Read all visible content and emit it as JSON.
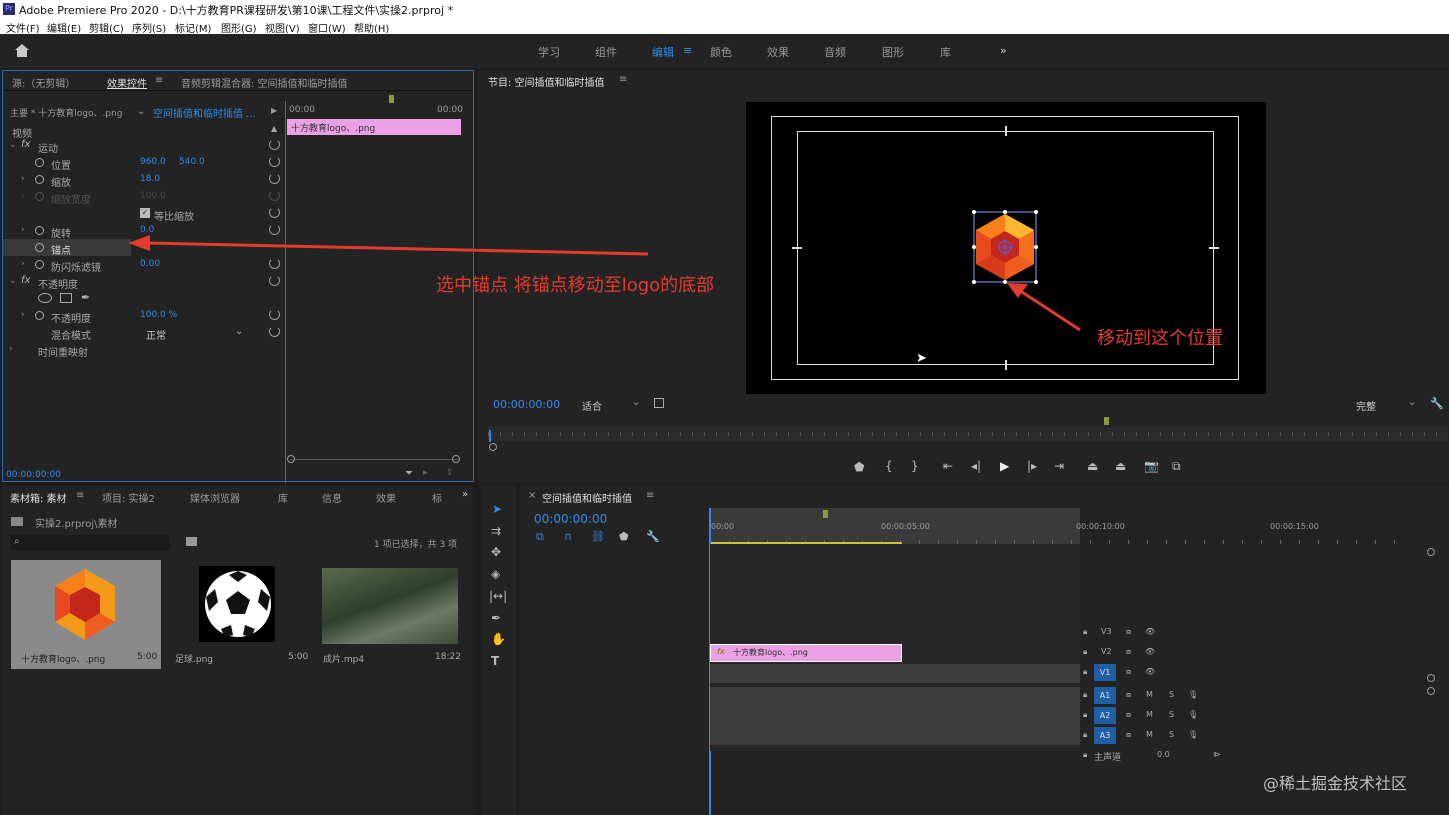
{
  "window": {
    "title": "Adobe Premiere Pro 2020 - D:\\十方教育PR课程研发\\第10课\\工程文件\\实操2.prproj *"
  },
  "menu": [
    "文件(F)",
    "编辑(E)",
    "剪辑(C)",
    "序列(S)",
    "标记(M)",
    "图形(G)",
    "视图(V)",
    "窗口(W)",
    "帮助(H)"
  ],
  "workspaces": [
    "学习",
    "组件",
    "编辑",
    "颜色",
    "效果",
    "音频",
    "图形",
    "库"
  ],
  "workspace_more": "»",
  "effect_controls": {
    "tabs": [
      "源:（无剪辑）",
      "效果控件",
      "音频剪辑混合器: 空间插值和临时插值"
    ],
    "master_clip": "主要 * 十方教育logo、.png",
    "sequence_clip": "空间插值和临时插值 ...",
    "time_start": "00:00",
    "time_end": "00:00",
    "clip_bar": "十方教育logo、.png",
    "section": "视频",
    "motion": "运动",
    "position": "位置",
    "position_x": "960.0",
    "position_y": "540.0",
    "scale": "缩放",
    "scale_val": "18.0",
    "scale_width": "缩放宽度",
    "scale_width_val": "100.0",
    "uniform": "等比缩放",
    "rotation": "旋转",
    "rotation_val": "0.0",
    "anchor": "锚点",
    "anti_flicker": "防闪烁滤镜",
    "anti_flicker_val": "0.00",
    "opacity": "不透明度",
    "opacity_prop": "不透明度",
    "opacity_val": "100.0 %",
    "blend": "混合模式",
    "blend_val": "正常",
    "time_remap": "时间重映射",
    "timecode": "00:00:00:00"
  },
  "annotation_left": "选中锚点 将锚点移动至logo的底部",
  "annotation_right": "移动到这个位置",
  "program": {
    "title": "节目: 空间插值和临时插值",
    "timecode": "00:00:00:00",
    "fit": "适合",
    "quality": "完整"
  },
  "project": {
    "tabs": [
      "素材箱: 素材",
      "项目: 实操2",
      "媒体浏览器",
      "库",
      "信息",
      "效果",
      "标"
    ],
    "path": "实操2.prproj\\素材",
    "selection": "1 项已选择，共 3 项",
    "items": [
      {
        "name": "十方教育logo、.png",
        "dur": "5:00"
      },
      {
        "name": "足球.png",
        "dur": "5:00"
      },
      {
        "name": "成片.mp4",
        "dur": "18:22"
      }
    ]
  },
  "timeline": {
    "title": "空间插值和临时插值",
    "timecode": "00:00:00:00",
    "ruler": [
      "00:00",
      "00:00:05:00",
      "00:00:10:00",
      "00:00:15:00"
    ],
    "video_tracks": [
      "V3",
      "V2",
      "V1"
    ],
    "audio_tracks": [
      "A1",
      "A2",
      "A3"
    ],
    "src_v": "V1",
    "clip": "十方教育logo、.png",
    "master": "主声道",
    "master_val": "0.0",
    "m": "M",
    "s": "S"
  },
  "watermark": "@稀土掘金技术社区",
  "colors": {
    "accent": "#2d8ceb",
    "clip": "#e9a0e4",
    "annotation": "#e33b2e",
    "track_target": "#1f5fa3"
  }
}
